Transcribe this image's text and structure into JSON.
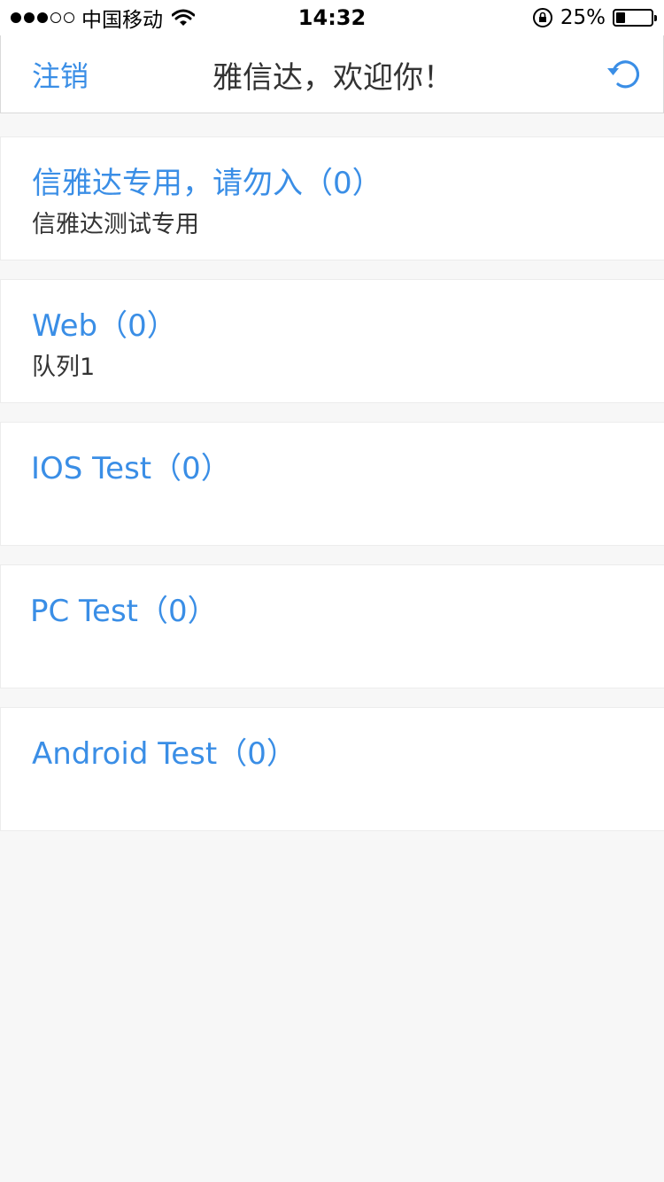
{
  "status_bar": {
    "carrier": "中国移动",
    "time": "14:32",
    "battery_percent": "25%",
    "battery_level": 0.25
  },
  "nav": {
    "left_button": "注销",
    "title": "雅信达，欢迎你！",
    "right_icon": "refresh-icon"
  },
  "queues": [
    {
      "title": "信雅达专用，请勿入（0）",
      "description": "信雅达测试专用"
    },
    {
      "title": "Web（0）",
      "description": "队列1"
    },
    {
      "title": "IOS Test（0）",
      "description": ""
    },
    {
      "title": "PC Test（0）",
      "description": ""
    },
    {
      "title": "Android Test（0）",
      "description": ""
    }
  ],
  "colors": {
    "accent": "#3a8ee6",
    "background": "#f7f7f7",
    "card": "#ffffff",
    "text": "#333333"
  }
}
